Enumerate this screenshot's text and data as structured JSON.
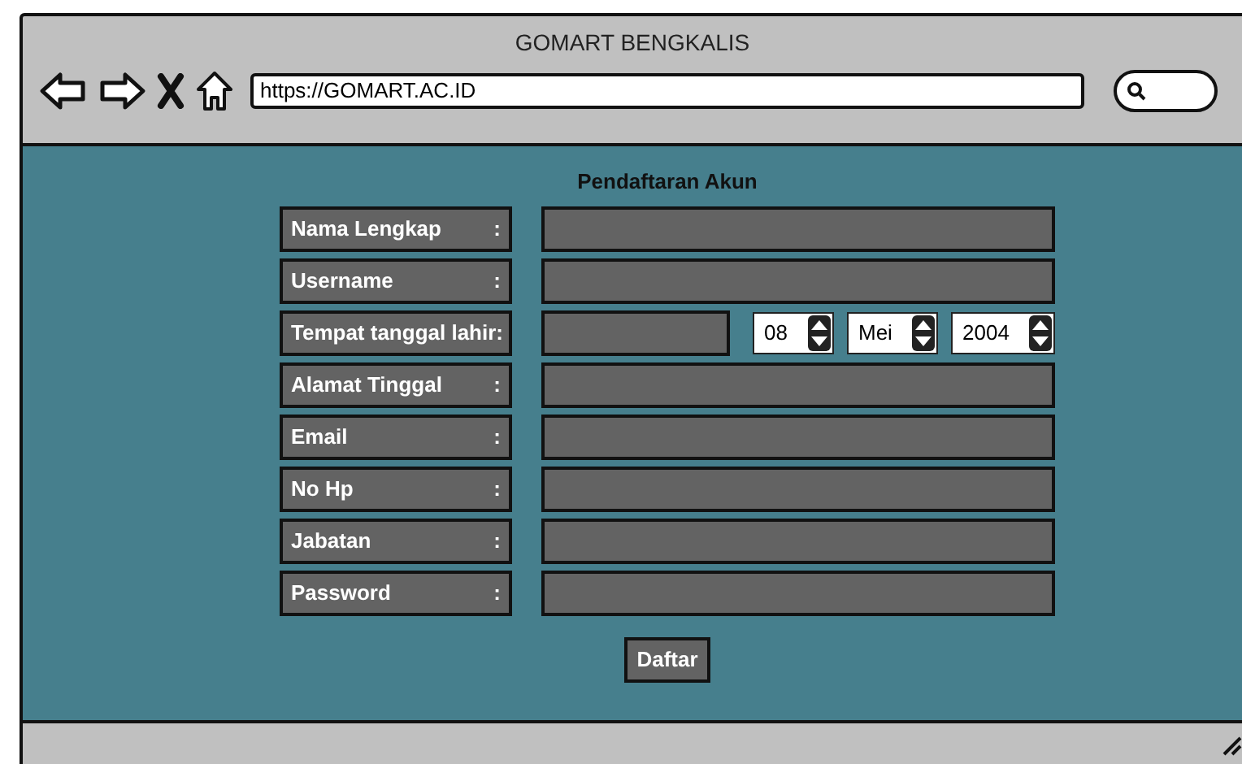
{
  "window": {
    "title": "GOMART BENGKALIS"
  },
  "address_bar": {
    "value": "https://GOMART.AC.ID"
  },
  "form": {
    "title": "Pendaftaran Akun",
    "rows": [
      {
        "kind": "text",
        "label": "Nama Lengkap",
        "colon": ":"
      },
      {
        "kind": "text",
        "label": "Username",
        "colon": ":"
      },
      {
        "kind": "date",
        "label": "Tempat tanggal lahir",
        "colon": ":",
        "spinners": [
          {
            "value": "08"
          },
          {
            "value": "Mei"
          },
          {
            "value": "2004"
          }
        ]
      },
      {
        "kind": "text",
        "label": "Alamat Tinggal",
        "colon": ":"
      },
      {
        "kind": "text",
        "label": "Email",
        "colon": ":"
      },
      {
        "kind": "text",
        "label": "No Hp",
        "colon": ":"
      },
      {
        "kind": "text",
        "label": "Jabatan",
        "colon": ":"
      },
      {
        "kind": "text",
        "label": "Password",
        "colon": ":"
      }
    ],
    "submit": "Daftar"
  }
}
